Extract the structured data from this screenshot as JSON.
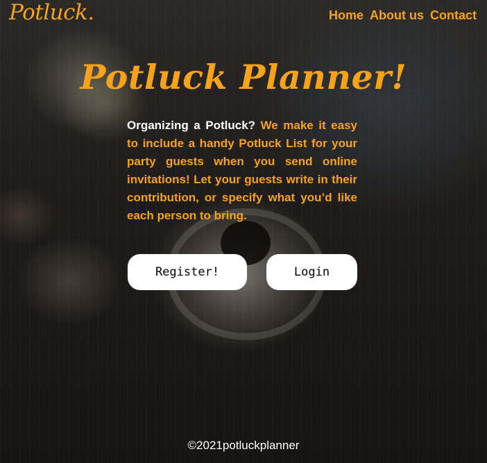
{
  "header": {
    "logo": "Potluck.",
    "nav": [
      {
        "label": "Home"
      },
      {
        "label": "About us"
      },
      {
        "label": "Contact"
      }
    ]
  },
  "hero": {
    "title": "Potluck Planner!",
    "intro_lead": "Organizing a Potluck?",
    "intro_body": "We make it easy to include a handy Potluck List for your party guests when you send online invitations! Let your guests write in their contribution, or specify what you’d like each person to bring.",
    "register_label": "Register!",
    "login_label": "Login"
  },
  "footer": {
    "copyright": "©2021potluckplanner"
  },
  "colors": {
    "accent": "#f7a21b",
    "text_light": "#ffffff",
    "button_bg": "#ffffff"
  }
}
